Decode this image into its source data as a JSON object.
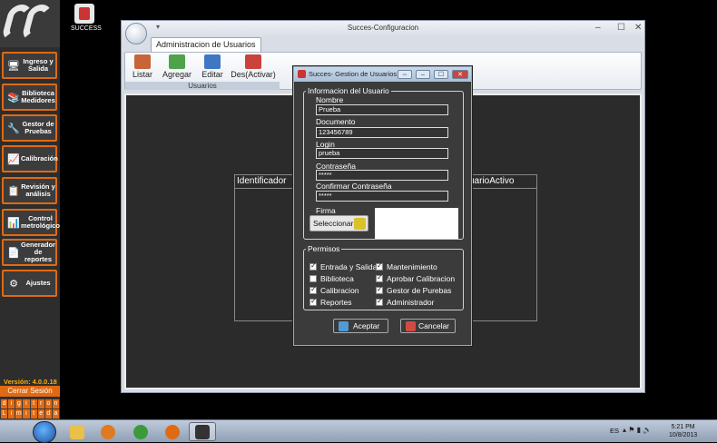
{
  "sidebar": {
    "items": [
      {
        "label": "Ingreso y Salida",
        "icon": "entry-exit-icon"
      },
      {
        "label": "Biblioteca Medidores",
        "icon": "library-icon"
      },
      {
        "label": "Gestor de Pruebas",
        "icon": "tests-manager-icon"
      },
      {
        "label": "Calibración",
        "icon": "calibration-icon"
      },
      {
        "label": "Revisión y análisis",
        "icon": "review-icon"
      },
      {
        "label": "Control metrológico",
        "icon": "control-icon"
      },
      {
        "label": "Generador de reportes",
        "icon": "reports-icon"
      },
      {
        "label": "Ajustes",
        "icon": "gear-icon"
      }
    ],
    "version": "Versión: 4.0.0.18",
    "logout": "Cerrar Sesión",
    "brand_top": [
      "d",
      "i",
      "g",
      "i",
      "t",
      "r",
      "o",
      "n"
    ],
    "brand_bottom": [
      "L",
      "i",
      "m",
      "i",
      "t",
      "e",
      "d",
      "a"
    ]
  },
  "success_logo": {
    "text": "SUCCESS",
    "mark_text": "Succes"
  },
  "window": {
    "title": "Succes-Configuracion",
    "tab": "Administracion de Usuarios",
    "ribbon": {
      "buttons": [
        "Listar",
        "Agregar",
        "Editar",
        "Des(Activar)"
      ],
      "group_label": "Usuarios"
    },
    "table_headers": [
      "Identificador",
      "uarioActivo"
    ]
  },
  "dialog": {
    "title": "Succes- Gestion de Usuarios",
    "info_legend": "Informacion del Usuario",
    "fields": [
      {
        "label": "Nombre",
        "value": "Prueba"
      },
      {
        "label": "Documento",
        "value": "123456789"
      },
      {
        "label": "Login",
        "value": "prueba"
      },
      {
        "label": "Contraseña",
        "value": "*****"
      },
      {
        "label": "Confirmar Contraseña",
        "value": "*****"
      }
    ],
    "firma_label": "Firma",
    "firma_button": "Seleccionar",
    "permisos_legend": "Permisos",
    "permisos": [
      {
        "label": "Entrada y Salida",
        "checked": true
      },
      {
        "label": "Mantenimiento",
        "checked": true
      },
      {
        "label": "Biblioteca",
        "checked": false
      },
      {
        "label": "Aprobar Calibracion",
        "checked": true
      },
      {
        "label": "Calibracion",
        "checked": true
      },
      {
        "label": "Gestor de Purebas",
        "checked": true
      },
      {
        "label": "Reportes",
        "checked": true
      },
      {
        "label": "Administrador",
        "checked": true
      }
    ],
    "accept": "Aceptar",
    "cancel": "Cancelar"
  },
  "taskbar": {
    "language": "ES",
    "time": "5:21 PM",
    "date": "10/8/2013"
  }
}
